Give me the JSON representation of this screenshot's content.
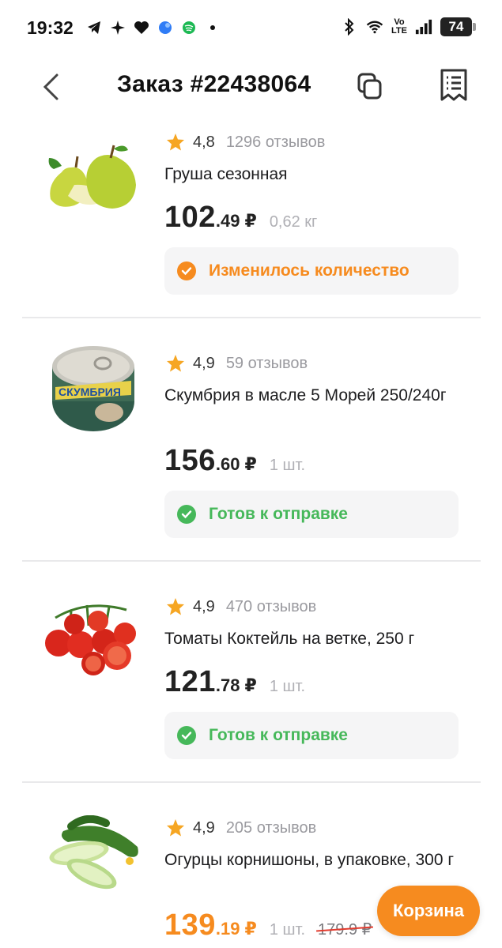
{
  "status_bar": {
    "time": "19:32",
    "volte_top": "Vo",
    "volte_bottom": "LTE",
    "battery": "74"
  },
  "header": {
    "title": "Заказ #22438064"
  },
  "products": [
    {
      "rating": "4,8",
      "reviews": "1296 отзывов",
      "name": "Груша сезонная",
      "price_int": "102",
      "price_frac": ".49",
      "currency": "₽",
      "qty": "0,62 кг",
      "status": "Изменилось количество",
      "status_type": "warning"
    },
    {
      "rating": "4,9",
      "reviews": "59 отзывов",
      "name": "Скумбрия в масле 5 Морей 250/240г",
      "price_int": "156",
      "price_frac": ".60",
      "currency": "₽",
      "qty": "1 шт.",
      "status": "Готов к отправке",
      "status_type": "ok",
      "image_label": "СКУМБРИЯ"
    },
    {
      "rating": "4,9",
      "reviews": "470 отзывов",
      "name": "Томаты Коктейль на ветке, 250 г",
      "price_int": "121",
      "price_frac": ".78",
      "currency": "₽",
      "qty": "1 шт.",
      "status": "Готов к отправке",
      "status_type": "ok"
    },
    {
      "rating": "4,9",
      "reviews": "205 отзывов",
      "name": "Огурцы корнишоны, в упаковке, 300 г",
      "price_int": "139",
      "price_frac": ".19",
      "currency": "₽",
      "qty": "1 шт.",
      "old_price": "179.9 ₽"
    }
  ],
  "cart_button": "Корзина",
  "colors": {
    "accent": "#f68b1f",
    "success": "#46b85a",
    "strike": "#e23b2e"
  },
  "icons": [
    "back-chevron-icon",
    "copy-icon",
    "receipt-icon",
    "star-icon",
    "check-circle-icon",
    "telegram-icon",
    "bluetooth-icon",
    "wifi-icon",
    "signal-icon"
  ]
}
